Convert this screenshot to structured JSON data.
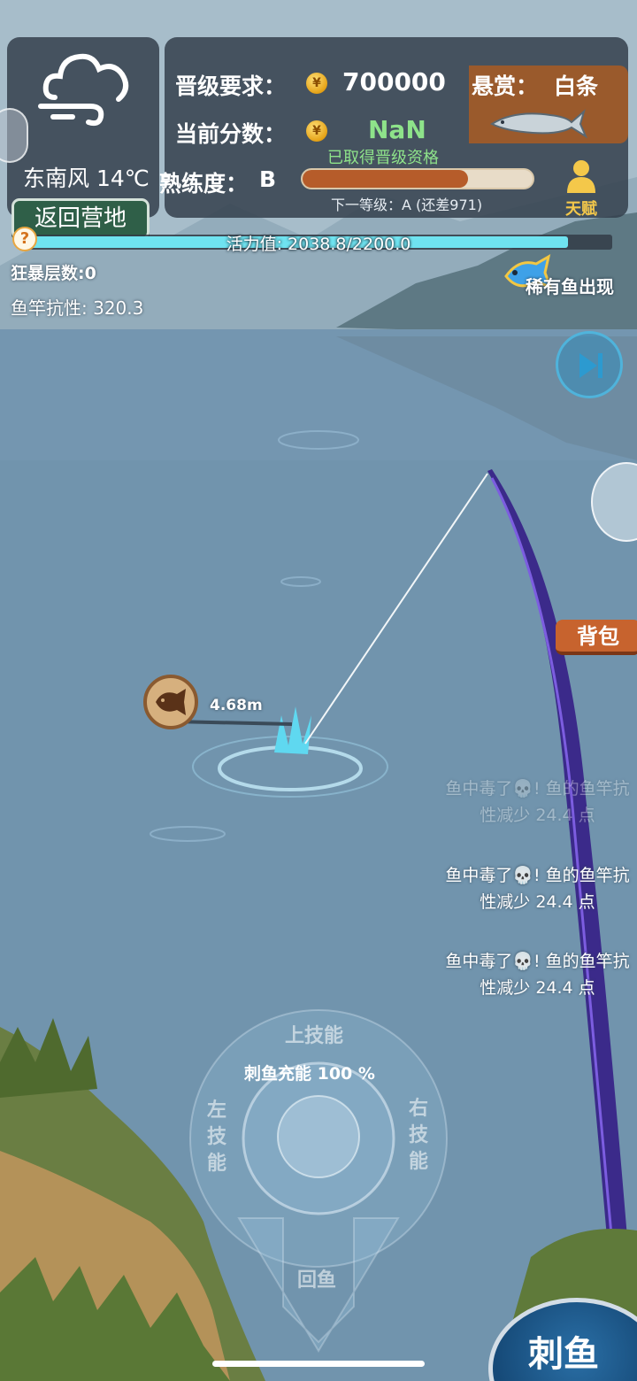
{
  "weather": {
    "wind_temp": "东南风 14℃",
    "camp_button": "返回营地"
  },
  "info": {
    "upgrade_label": "晋级要求：",
    "upgrade_value": "700000",
    "bounty_label": "悬赏：",
    "bounty_value": "白条",
    "score_label": "当前分数：",
    "score_value": "NaN",
    "qualified_text": "已取得晋级资格",
    "proficiency_label": "熟练度：",
    "proficiency_grade": "B",
    "proficiency_progress": 0.72,
    "next_level_text": "下一等级：A (还差971)",
    "talent_label": "天赋",
    "coin_symbol": "¥"
  },
  "energy": {
    "text": "活力值: 2038.8/2200.0",
    "current": 2038.8,
    "max": 2200.0,
    "help_symbol": "?"
  },
  "status": {
    "rage": "狂暴层数:0",
    "rod_resistance": "鱼竿抗性: 320.3",
    "rare_fish": "稀有鱼出现"
  },
  "buttons": {
    "bag": "背包",
    "strike": "刺鱼"
  },
  "fish": {
    "distance": "4.68m"
  },
  "log": [
    {
      "line1": "鱼中毒了💀! 鱼的鱼竿抗",
      "line2": "性减少 24.4 点"
    },
    {
      "line1": "鱼中毒了💀! 鱼的鱼竿抗",
      "line2": "性减少 24.4 点"
    },
    {
      "line1": "鱼中毒了💀! 鱼的鱼竿抗",
      "line2": "性减少 24.4 点"
    }
  ],
  "controls": {
    "up_skill": "上技能",
    "left_skill": [
      "左",
      "技",
      "能"
    ],
    "right_skill": [
      "右",
      "技",
      "能"
    ],
    "reel": "回鱼",
    "charge": "刺鱼充能 100 %"
  },
  "colors": {
    "accent": "#6fe3f0",
    "qualified": "#8ee38a",
    "bag": "#c7632e",
    "strike": "#164a78"
  }
}
